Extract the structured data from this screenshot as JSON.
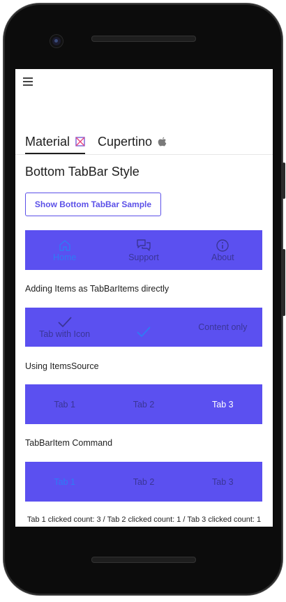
{
  "top_tabs": [
    {
      "label": "Material",
      "icon": "material-logo-icon",
      "active": true
    },
    {
      "label": "Cupertino",
      "icon": "apple-icon",
      "active": false
    }
  ],
  "heading": "Bottom TabBar Style",
  "show_sample_button": "Show Bottom TabBar Sample",
  "bar1": {
    "items": [
      {
        "label": "Home",
        "icon": "home-icon",
        "selected": true
      },
      {
        "label": "Support",
        "icon": "chat-bubbles-icon",
        "selected": false
      },
      {
        "label": "About",
        "icon": "info-circle-icon",
        "selected": false
      }
    ]
  },
  "section2_label": "Adding Items as TabBarItems directly",
  "bar2": {
    "items": [
      {
        "label": "Tab with Icon",
        "icon": "check-icon"
      },
      {
        "label": "",
        "icon": "check-icon"
      },
      {
        "label": "Content only",
        "icon": ""
      }
    ]
  },
  "section3_label": "Using ItemsSource",
  "bar3": {
    "items": [
      {
        "label": "Tab 1"
      },
      {
        "label": "Tab 2"
      },
      {
        "label": "Tab 3"
      }
    ]
  },
  "section4_label": "TabBarItem Command",
  "bar4": {
    "items": [
      {
        "label": "Tab 1"
      },
      {
        "label": "Tab 2"
      },
      {
        "label": "Tab 3"
      }
    ]
  },
  "footer_text": "Tab 1 clicked count: 3 / Tab 2 clicked count: 1 / Tab 3 clicked count: 1",
  "colors": {
    "accent": "#5b50f0",
    "selected": "#2d7cf6",
    "unselected": "#3a3596"
  }
}
